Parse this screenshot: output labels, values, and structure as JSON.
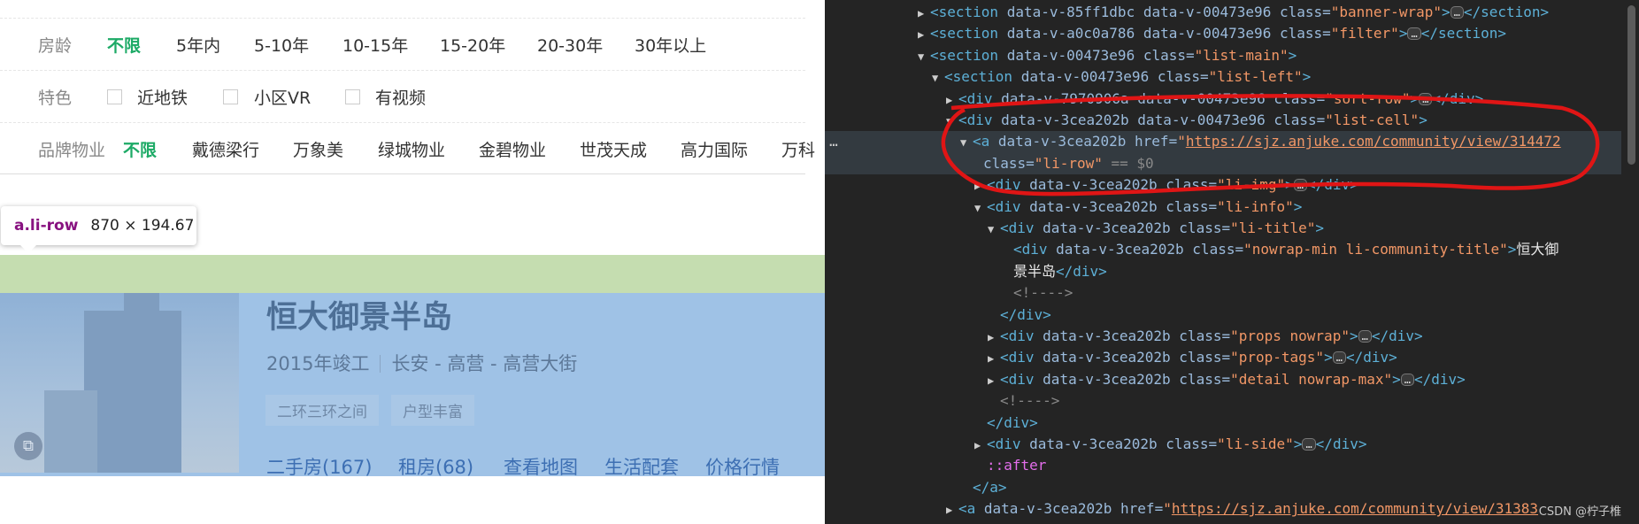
{
  "filter": {
    "age": {
      "label": "房龄",
      "options": [
        "不限",
        "5年内",
        "5-10年",
        "10-15年",
        "15-20年",
        "20-30年",
        "30年以上"
      ]
    },
    "feature": {
      "label": "特色",
      "options": [
        "近地铁",
        "小区VR",
        "有视频"
      ]
    },
    "brand": {
      "label": "品牌物业",
      "options": [
        "不限",
        "戴德梁行",
        "万象美",
        "绿城物业",
        "金碧物业",
        "世茂天成",
        "高力国际",
        "万科"
      ]
    }
  },
  "tooltip": {
    "selector": "a.li-row",
    "size": "870 × 194.67"
  },
  "community": {
    "title": "恒大御景半岛",
    "year": "2015年竣工",
    "location": "长安 - 高营 - 高营大街",
    "tags": [
      "二环三环之间",
      "户型丰富"
    ],
    "vr_icon": "vr-icon",
    "links": [
      "二手房(167)",
      "租房(68)",
      "查看地图",
      "生活配套",
      "价格行情"
    ]
  },
  "devtools": {
    "lines": [
      {
        "tag": "section",
        "attrs": "data-v-85ff1dbc data-v-00473e96 class=",
        "cls": "\"banner-wrap\"",
        "tail": "</section>"
      },
      {
        "tag": "section",
        "attrs": "data-v-a0c0a786 data-v-00473e96 class=",
        "cls": "\"filter\"",
        "tail": "</section>"
      },
      {
        "tag": "section",
        "attrs": "data-v-00473e96 class=",
        "cls": "\"list-main\""
      },
      {
        "tag": "section",
        "attrs": "data-v-00473e96 class=",
        "cls": "\"list-left\""
      },
      {
        "tag": "div",
        "attrs": "data-v-7970906a data-v-00473e96 class=",
        "cls": "\"sort-row\"",
        "tail": "</div>"
      },
      {
        "tag": "div",
        "attrs": "data-v-3cea202b data-v-00473e96 class=",
        "cls": "\"list-cell\""
      },
      {
        "tag": "a",
        "attrs": "data-v-3cea202b href=",
        "url": "https://sjz.anjuke.com/community/view/314472"
      },
      {
        "attrs": "class=",
        "cls": "\"li-row\"",
        "eq": "== $0"
      },
      {
        "tag": "div",
        "attrs": "data-v-3cea202b class=",
        "cls": "\"li-img\"",
        "tail": "</div>"
      },
      {
        "tag": "div",
        "attrs": "data-v-3cea202b class=",
        "cls": "\"li-info\""
      },
      {
        "tag": "div",
        "attrs": "data-v-3cea202b class=",
        "cls": "\"li-title\""
      },
      {
        "tag": "div",
        "attrs": "data-v-3cea202b class=",
        "cls": "\"nowrap-min li-community-title\"",
        "text": "恒大御"
      },
      {
        "text": "景半岛",
        "close": "</div>"
      },
      {
        "comment": "<!---->"
      },
      {
        "close": "</div>"
      },
      {
        "tag": "div",
        "attrs": "data-v-3cea202b class=",
        "cls": "\"props nowrap\"",
        "tail": "</div>"
      },
      {
        "tag": "div",
        "attrs": "data-v-3cea202b class=",
        "cls": "\"prop-tags\"",
        "tail": "</div>"
      },
      {
        "tag": "div",
        "attrs": "data-v-3cea202b class=",
        "cls": "\"detail nowrap-max\"",
        "tail": "</div>"
      },
      {
        "comment": "<!---->"
      },
      {
        "close": "</div>"
      },
      {
        "tag": "div",
        "attrs": "data-v-3cea202b class=",
        "cls": "\"li-side\"",
        "tail": "</div>"
      },
      {
        "pseudo": "::after"
      },
      {
        "close": "</a>"
      },
      {
        "tag": "a",
        "attrs": "data-v-3cea202b href=",
        "url": "https://sjz.anjuke.com/community/view/31383"
      }
    ],
    "dots_label": "…",
    "gutter": "…",
    "watermark": "CSDN @柠子椎"
  }
}
